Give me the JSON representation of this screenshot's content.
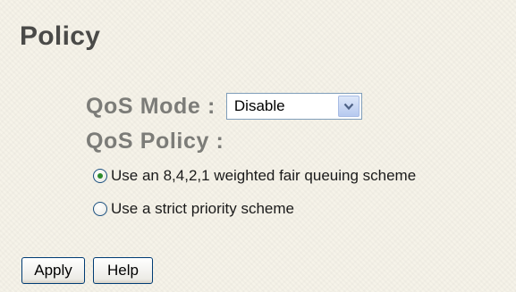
{
  "page": {
    "title": "Policy"
  },
  "qos_mode": {
    "label": "QoS Mode :",
    "selected": "Disable"
  },
  "qos_policy": {
    "label": "QoS Policy :",
    "options": [
      {
        "label": "Use an 8,4,2,1 weighted fair queuing scheme",
        "checked": true
      },
      {
        "label": "Use a strict priority scheme",
        "checked": false
      }
    ]
  },
  "buttons": {
    "apply": "Apply",
    "help": "Help"
  }
}
